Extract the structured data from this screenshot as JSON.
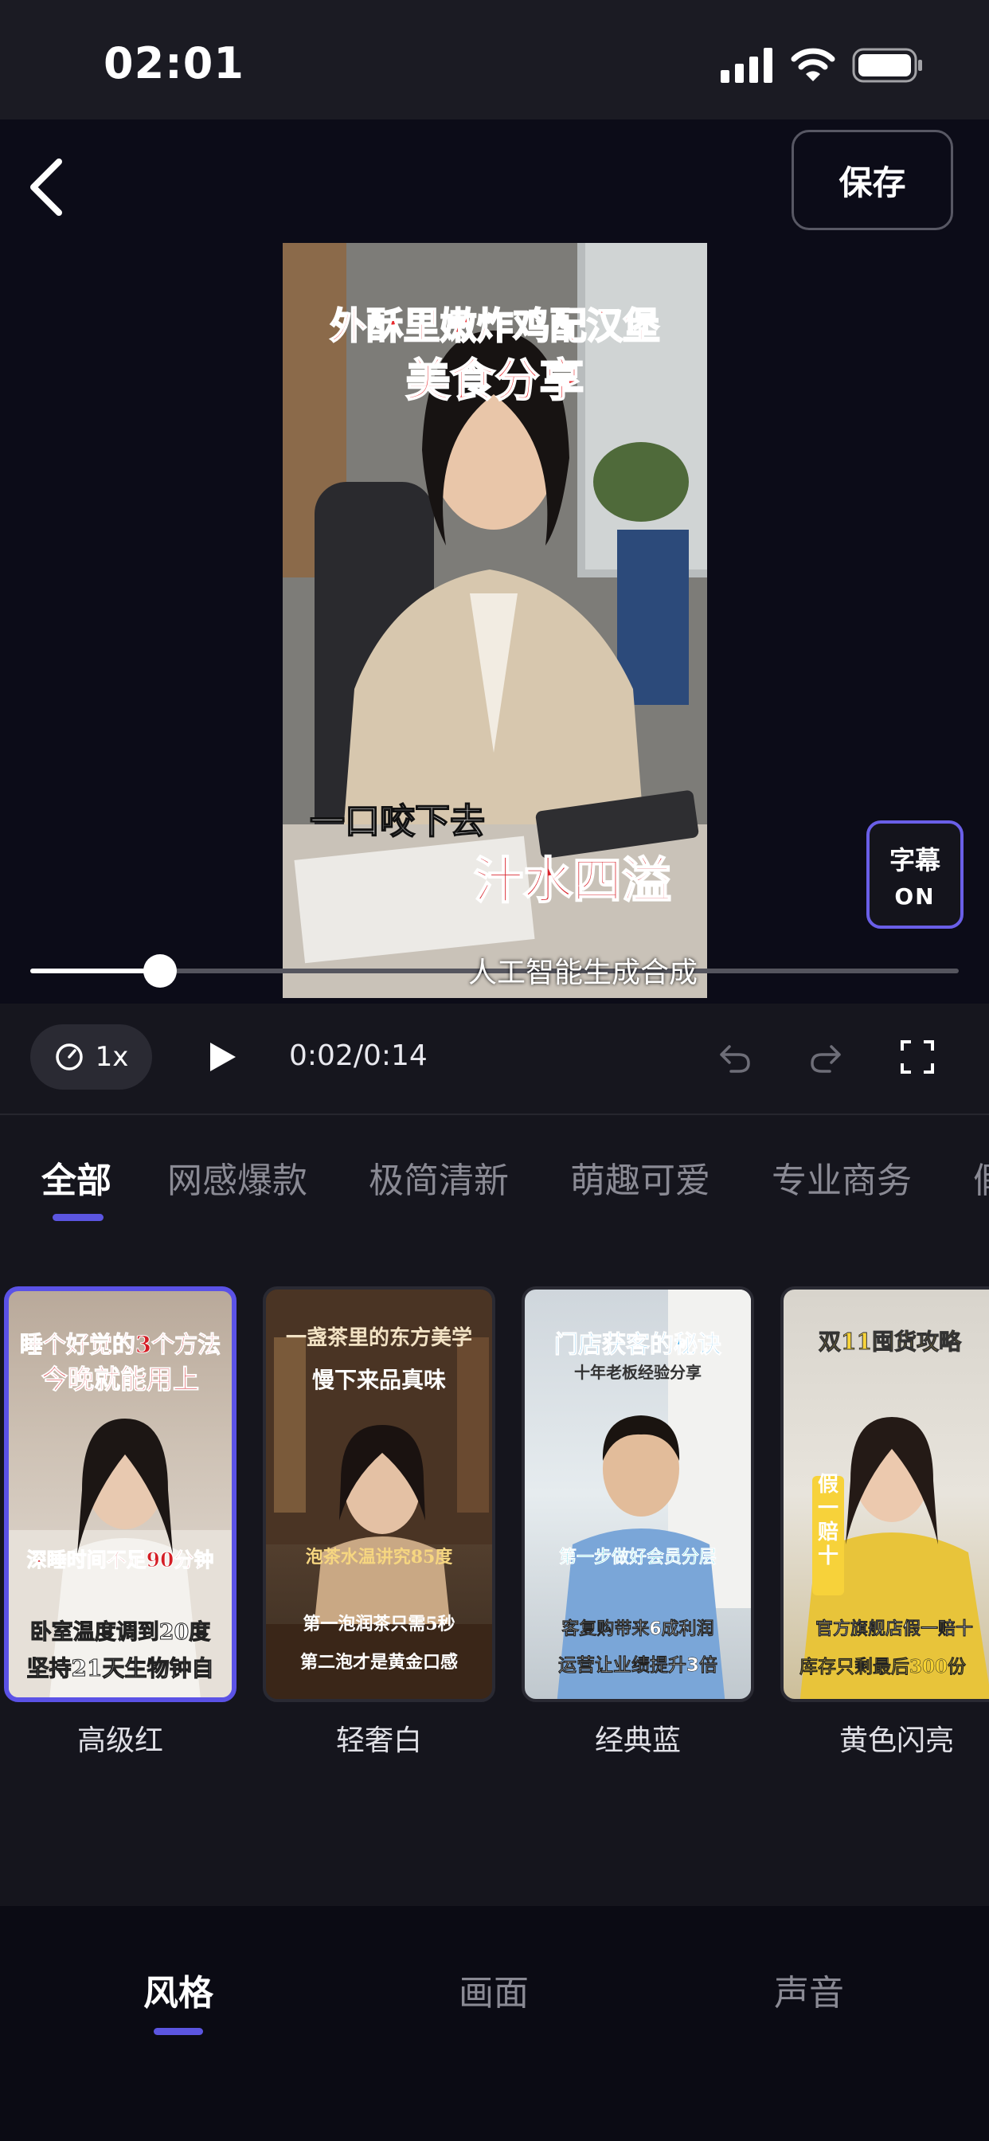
{
  "status_bar": {
    "time": "02:01"
  },
  "header": {
    "save_label": "保存"
  },
  "video": {
    "title_line1": "外酥里嫩炸鸡配汉堡",
    "title_line2": "美食分享",
    "caption_line1": "一口咬下去",
    "caption_line2": "汁水四溢",
    "watermark": "人工智能生成合成"
  },
  "subtitle_toggle": {
    "label": "字幕",
    "state": "ON"
  },
  "player": {
    "speed": "1x",
    "timecode": "0:02/0:14",
    "progress": 0.14
  },
  "category_tabs": [
    {
      "label": "全部"
    },
    {
      "label": "网感爆款"
    },
    {
      "label": "极简清新"
    },
    {
      "label": "萌趣可爱"
    },
    {
      "label": "专业商务"
    },
    {
      "label": "假"
    }
  ],
  "styles": [
    {
      "name": "高级红",
      "lines": [
        "睡个好觉的3个方法",
        "今晚就能用上",
        "深睡时间不足90分钟",
        "卧室温度调到20度",
        "坚持21天生物钟自"
      ]
    },
    {
      "name": "轻奢白",
      "lines": [
        "一盏茶里的东方美学",
        "慢下来品真味",
        "泡茶水温讲究85度",
        "第一泡润茶只需5秒",
        "第二泡才是黄金口感"
      ]
    },
    {
      "name": "经典蓝",
      "lines": [
        "门店获客的秘诀",
        "十年老板经验分享",
        "第一步做好会员分层",
        "客复购带来6成利润",
        "运营让业绩提升3倍"
      ]
    },
    {
      "name": "黄色闪亮",
      "lines": [
        "双11囤货攻略",
        "假一赔十",
        "官方旗舰店假一赔十",
        "库存只剩最后300份"
      ]
    }
  ],
  "bottom_nav": [
    {
      "label": "风格"
    },
    {
      "label": "画面"
    },
    {
      "label": "声音"
    }
  ],
  "colors": {
    "accent": "#5b55e0",
    "caption_red": "#d8242c",
    "background": "#15151d"
  }
}
